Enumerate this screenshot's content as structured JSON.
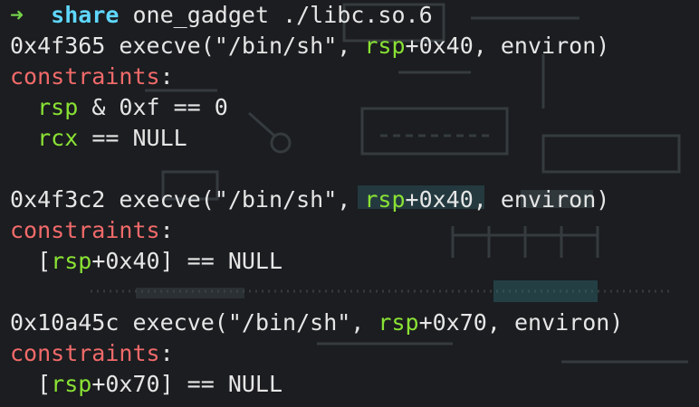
{
  "colors": {
    "background": "#1b1d20",
    "prompt_arrow": "#74d14a",
    "command": "#5fd7ff",
    "text": "#e6e6e6",
    "register": "#8ae234",
    "constraints_keyword": "#f26a6a"
  },
  "prompt": {
    "arrow": "➜",
    "command": "share",
    "args": "one_gadget ./libc.so.6"
  },
  "gadgets": [
    {
      "address": "0x4f365",
      "call_prefix": "execve(\"/bin/sh\", ",
      "reg": "rsp",
      "offset": "+0x40",
      "call_suffix": ", environ)",
      "constraints_label": "constraints",
      "colon": ":",
      "constraints": [
        {
          "indent": "  ",
          "reg": "rsp",
          "rest": " & 0xf == 0"
        },
        {
          "indent": "  ",
          "reg": "rcx",
          "rest": " == NULL"
        }
      ]
    },
    {
      "address": "0x4f3c2",
      "call_prefix": "execve(\"/bin/sh\", ",
      "reg": "rsp",
      "offset": "+0x40",
      "call_suffix": ", environ)",
      "constraints_label": "constraints",
      "colon": ":",
      "constraints": [
        {
          "indent": "  [",
          "reg": "rsp",
          "rest": "+0x40] == NULL"
        }
      ]
    },
    {
      "address": "0x10a45c",
      "call_prefix": "execve(\"/bin/sh\", ",
      "reg": "rsp",
      "offset": "+0x70",
      "call_suffix": ", environ)",
      "constraints_label": "constraints",
      "colon": ":",
      "constraints": [
        {
          "indent": "  [",
          "reg": "rsp",
          "rest": "+0x70] == NULL"
        }
      ]
    }
  ]
}
